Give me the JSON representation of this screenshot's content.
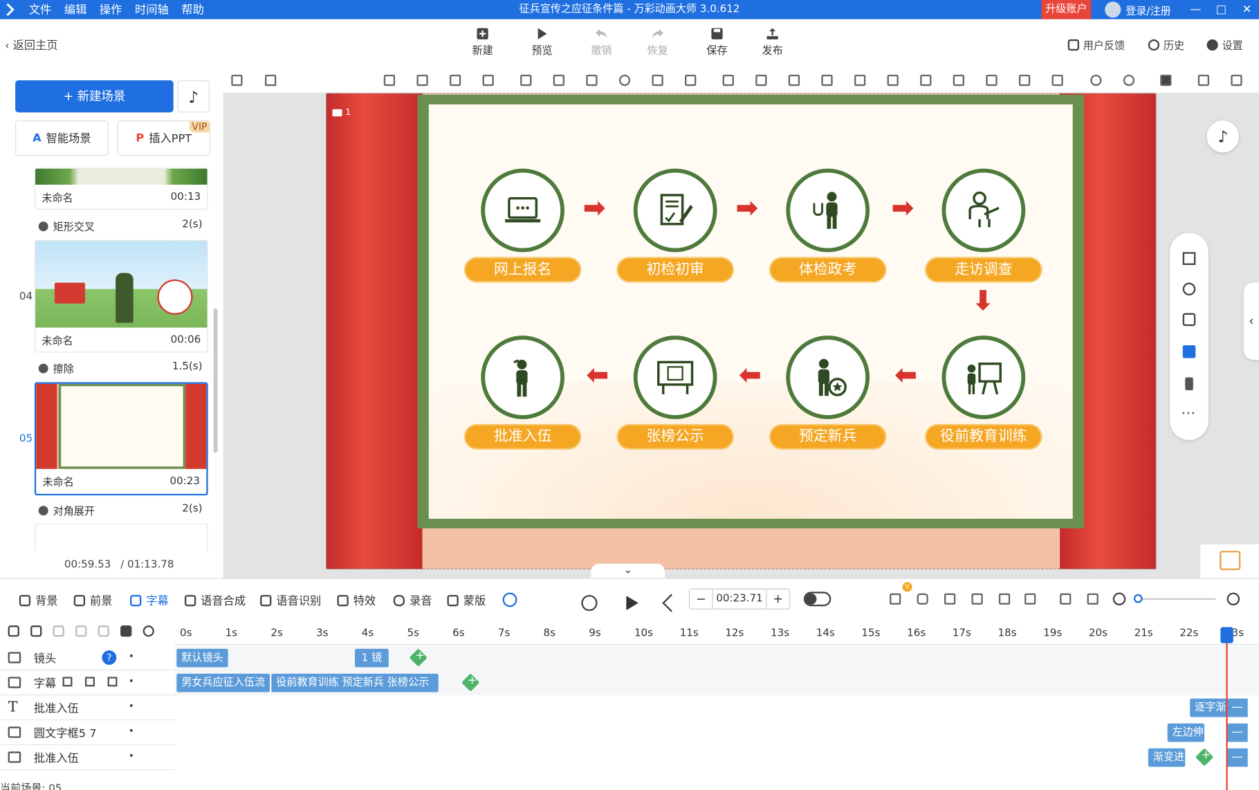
{
  "titlebar": {
    "menus": [
      "文件",
      "编辑",
      "操作",
      "时间轴",
      "帮助"
    ],
    "title": "征兵宣传之应征条件篇 - 万彩动画大师 3.0.612",
    "upgrade": "升级账户",
    "login": "登录/注册",
    "min": "—",
    "max": "□",
    "close": "✕"
  },
  "toolbar": {
    "back": "返回主页",
    "new": "新建",
    "preview": "预览",
    "undo": "撤销",
    "redo": "恢复",
    "save": "保存",
    "publish": "发布",
    "feedback": "用户反馈",
    "history": "历史",
    "settings": "设置"
  },
  "left": {
    "new_scene": "新建场景",
    "music": "♪",
    "smart_scene": "智能场景",
    "insert_ppt": "插入PPT",
    "vip": "VIP",
    "scenes": [
      {
        "num": "",
        "name": "未命名",
        "dur": "00:13"
      },
      {
        "num": "04",
        "name": "未命名",
        "dur": "00:06"
      },
      {
        "num": "05",
        "name": "未命名",
        "dur": "00:23"
      }
    ],
    "transitions": [
      {
        "name": "矩形交叉",
        "dur": "2(s)"
      },
      {
        "name": "擦除",
        "dur": "1.5(s)"
      },
      {
        "name": "对角展开",
        "dur": "2(s)"
      }
    ],
    "time_current": "00:59.53",
    "time_total": "/ 01:13.78"
  },
  "stage": {
    "cam_num": "1",
    "steps_top": [
      "网上报名",
      "初检初审",
      "体检政考",
      "走访调查"
    ],
    "steps_bottom": [
      "批准入伍",
      "张榜公示",
      "预定新兵",
      "役前教育训练"
    ],
    "arrow_right": "➡",
    "arrow_left": "⬅",
    "arrow_down": "⬇",
    "fab_music": "♪",
    "more": "⋯",
    "collapse": "⌄",
    "side_tab": "‹"
  },
  "bottom": {
    "tabs": [
      "背景",
      "前景",
      "字幕",
      "语音合成",
      "语音识别",
      "特效",
      "录音",
      "蒙版"
    ],
    "time": "00:23.71",
    "minus": "−",
    "plus": "+",
    "v_badge": "V",
    "ruler": [
      "0s",
      "1s",
      "2s",
      "3s",
      "4s",
      "5s",
      "6s",
      "7s",
      "8s",
      "9s",
      "10s",
      "11s",
      "12s",
      "13s",
      "14s",
      "15s",
      "16s",
      "17s",
      "18s",
      "19s",
      "20s",
      "21s",
      "22s",
      "23s"
    ],
    "tracks": [
      {
        "label": "镜头",
        "chips": [
          "默认镜头",
          "1 镜"
        ]
      },
      {
        "label": "字幕",
        "chips": [
          "男女兵应征入伍流",
          "役前教育训练 预定新兵 张榜公示"
        ]
      },
      {
        "label": "批准入伍",
        "chips": [
          "逐字渐"
        ]
      },
      {
        "label": "圆文字框5 7",
        "chips": [
          "左边伸"
        ]
      },
      {
        "label": "批准入伍",
        "chips": [
          "渐变进"
        ]
      }
    ],
    "current_scene": "当前场景: 05",
    "help": "?",
    "track_dots": "• •",
    "minus_chip": "—"
  },
  "colors": {
    "accent": "#1f6fe0",
    "upgrade": "#e8463a",
    "green": "#4e7a3b",
    "pill": "#f5a623",
    "arrow": "#d8332c",
    "chip": "#5b9bd9"
  }
}
